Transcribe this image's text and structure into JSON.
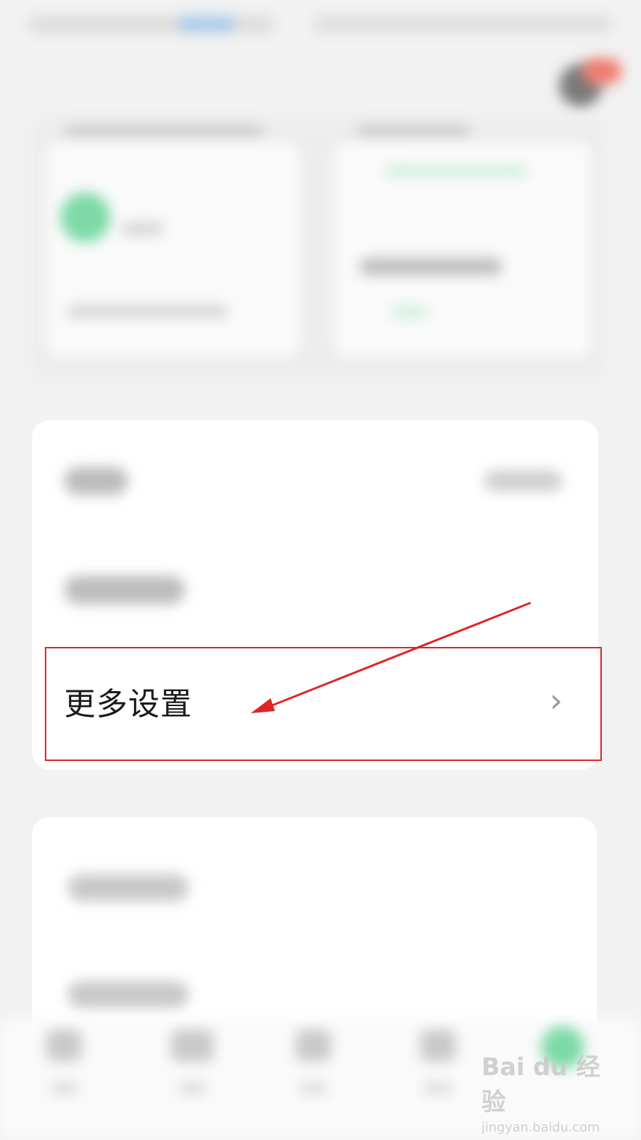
{
  "settings": {
    "more_settings_label": "更多设置",
    "chevron": "›"
  },
  "watermark": {
    "brand": "Bai du 经验",
    "url": "jingyan.baidu.com"
  },
  "colors": {
    "annotation_red": "#e02424",
    "accent_green": "#7dd9a8"
  }
}
